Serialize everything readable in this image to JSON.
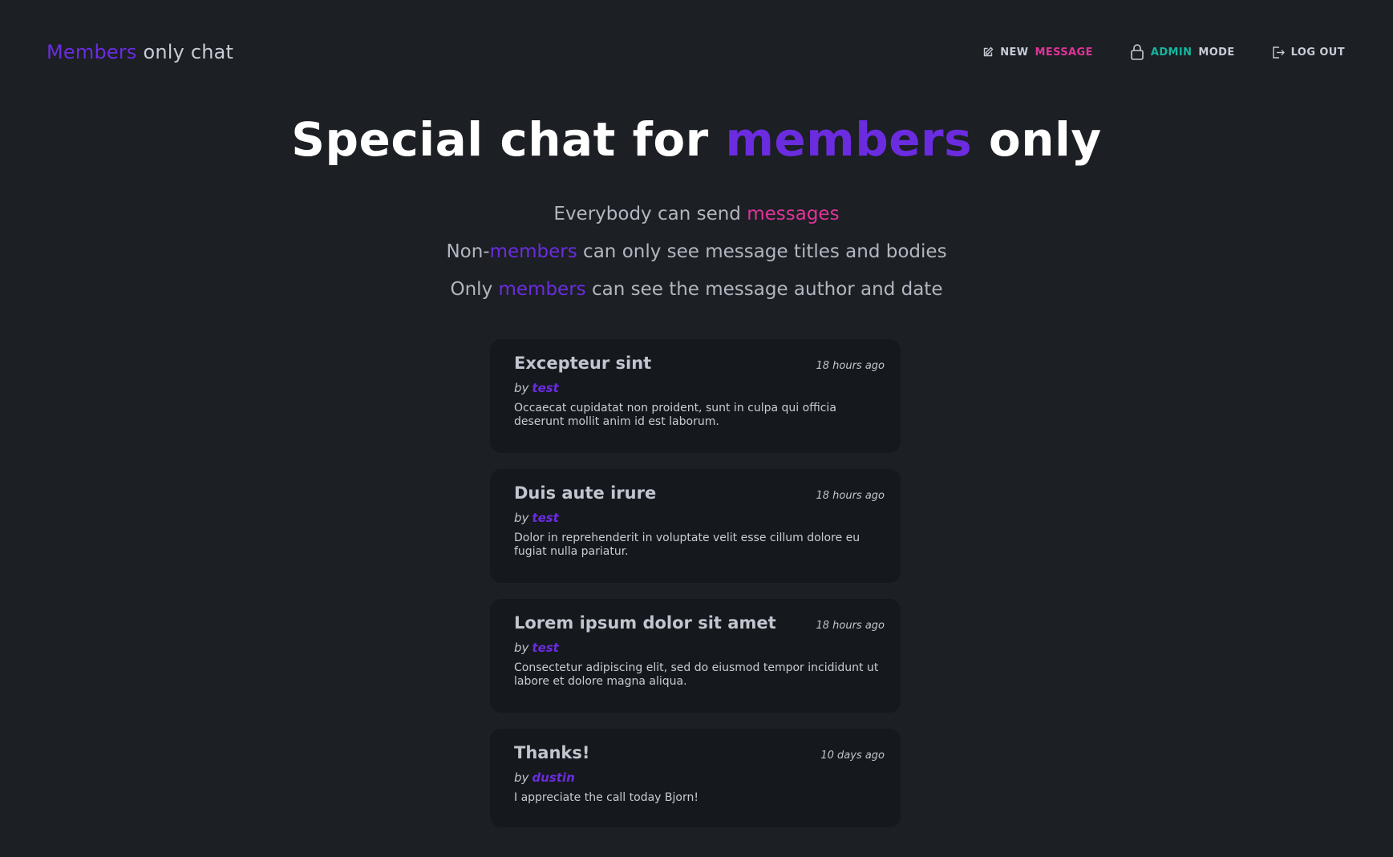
{
  "brand": {
    "accent": "Members",
    "rest": " only chat"
  },
  "nav": {
    "new_message": {
      "part1": "NEW",
      "part2": "MESSAGE",
      "icon": "edit-icon"
    },
    "admin_mode": {
      "part1": "ADMIN",
      "part2": "MODE",
      "icon": "lock-icon"
    },
    "logout": {
      "label": "LOG OUT",
      "icon": "logout-icon"
    }
  },
  "hero": {
    "pre": "Special chat for ",
    "accent": "members",
    "post": " only"
  },
  "subtitles": [
    {
      "pre": "Everybody can send ",
      "accent": "messages",
      "post": ""
    },
    {
      "pre": "Non-",
      "accent": "members",
      "post": " can only see message titles and bodies"
    },
    {
      "pre": "Only ",
      "accent": "members",
      "post": " can see the message author and date"
    }
  ],
  "messages": [
    {
      "title": "Excepteur sint",
      "time": "18 hours ago",
      "by": "by",
      "author": "test",
      "body": "Occaecat cupidatat non proident, sunt in culpa qui officia deserunt mollit anim id est laborum."
    },
    {
      "title": "Duis aute irure",
      "time": "18 hours ago",
      "by": "by",
      "author": "test",
      "body": "Dolor in reprehenderit in voluptate velit esse cillum dolore eu fugiat nulla pariatur."
    },
    {
      "title": "Lorem ipsum dolor sit amet",
      "time": "18 hours ago",
      "by": "by",
      "author": "test",
      "body": "Consectetur adipiscing elit, sed do eiusmod tempor incididunt ut labore et dolore magna aliqua."
    },
    {
      "title": "Thanks!",
      "time": "10 days ago",
      "by": "by",
      "author": "dustin",
      "body": "I appreciate the call today Bjorn!"
    }
  ],
  "colors": {
    "background": "#1c1f23",
    "card": "#15181c",
    "accent_purple": "#6b2ce0",
    "accent_pink": "#e0339a",
    "accent_teal": "#16b6a0"
  }
}
